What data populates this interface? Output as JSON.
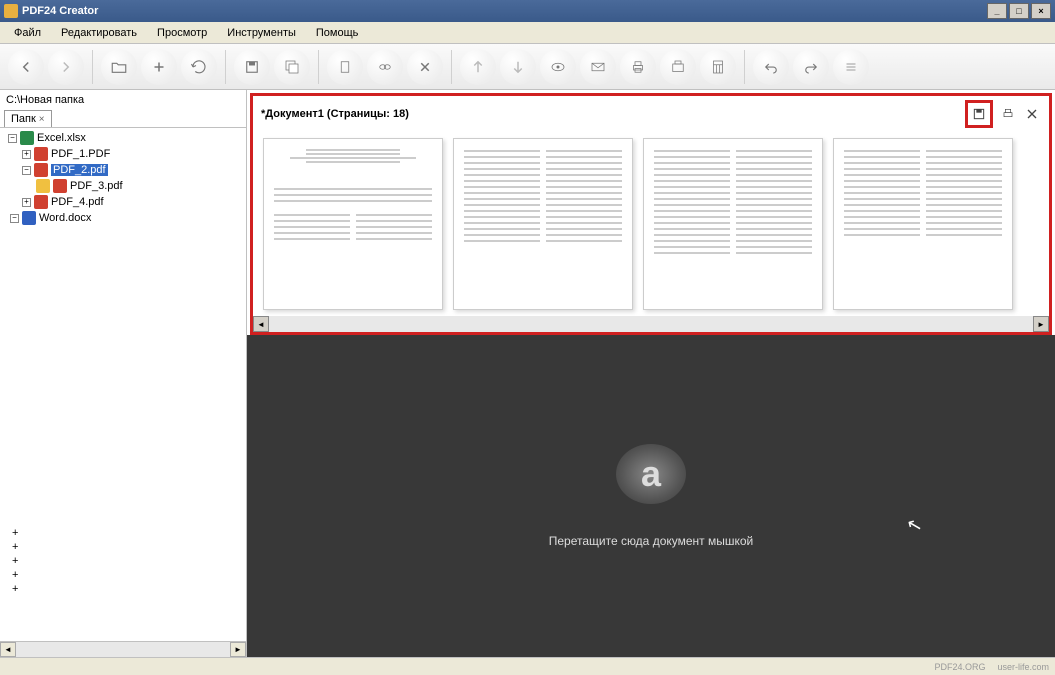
{
  "window": {
    "title": "PDF24 Creator"
  },
  "menubar": [
    "Файл",
    "Редактировать",
    "Просмотр",
    "Инструменты",
    "Помощь"
  ],
  "sidebar": {
    "path": "С:\\Новая папка",
    "tab_label": "Папк",
    "items": [
      {
        "label": "Excel.xlsx",
        "type": "excel"
      },
      {
        "label": "PDF_1.PDF",
        "type": "pdf"
      },
      {
        "label": "PDF_2.pdf",
        "type": "pdf",
        "selected": true
      },
      {
        "label": "PDF_3.pdf",
        "type": "pdf"
      },
      {
        "label": "PDF_4.pdf",
        "type": "pdf"
      },
      {
        "label": "Word.docx",
        "type": "word"
      }
    ]
  },
  "document": {
    "title": "*Документ1 (Страницы: 18)"
  },
  "drop_area": {
    "logo_char": "a",
    "hint": "Перетащите сюда документ мышкой"
  },
  "footer": {
    "watermark1": "PDF24.ORG",
    "watermark2": "user-life.com"
  }
}
